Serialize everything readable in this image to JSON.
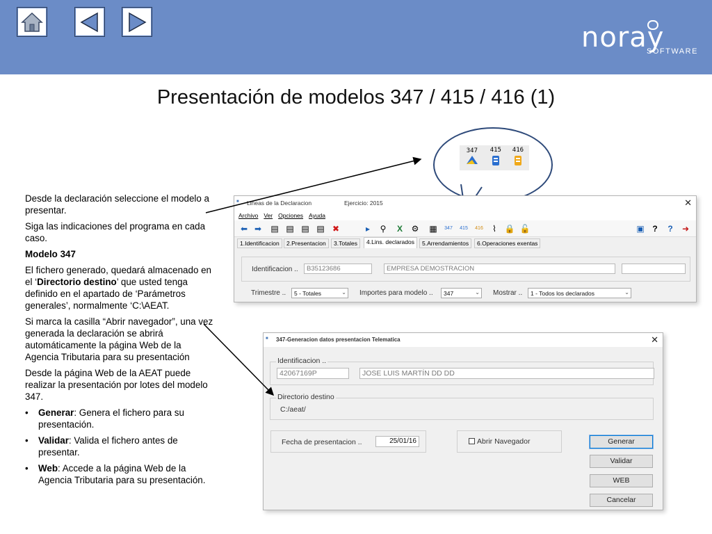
{
  "slide": {
    "title": "Presentación de modelos 347 / 415 / 416 (1)"
  },
  "header": {
    "logo_main": "noray",
    "logo_sub": "SOFTWARE",
    "nav": [
      "home-icon",
      "previous-icon",
      "next-icon"
    ]
  },
  "instructions": {
    "p1": "Desde la declaración seleccione el modelo a presentar.",
    "p2": "Siga las indicaciones del programa en cada caso.",
    "heading": "Modelo 347",
    "p3_a": "El fichero generado, quedará almacenado en el ‘",
    "p3_b": "Directorio destino",
    "p3_c": "’ que usted tenga definido en el apartado de ‘Parámetros generales’, normalmente ‘C:\\AEAT.",
    "p4": "Si marca la casilla “Abrir navegador”, una vez generada la declaración se abrirá automáticamente la página Web de la Agencia Tributaria para su presentación",
    "p5": "Desde la página Web de la AEAT puede realizar la presentación por lotes del modelo 347.",
    "bullets": [
      {
        "term": "Generar",
        "text": ": Genera el fichero para su presentación."
      },
      {
        "term": "Validar",
        "text": ": Valida el fichero antes de presentar."
      },
      {
        "term": "Web",
        "text": ": Accede a la página Web de la Agencia Tributaria para su presentación."
      }
    ]
  },
  "callout": {
    "icons": [
      "347",
      "415",
      "416"
    ]
  },
  "window1": {
    "title": "Lineas de la Declaracion",
    "ejercicio": "Ejercicio: 2015",
    "menu": [
      "Archivo",
      "Ver",
      "Opciones",
      "Ayuda"
    ],
    "tabs": [
      "1.Identificacion",
      "2.Presentacion",
      "3.Totales",
      "4.Lins. declarados",
      "5.Arrendamientos",
      "6.Operaciones exentas"
    ],
    "identificacion_label": "Identificacion ..",
    "nif": "B35123686",
    "empresa": "EMPRESA DEMOSTRACION",
    "trimestre_label": "Trimestre ..",
    "trimestre_value": "5 - Totales",
    "importes_label": "Importes para modelo ..",
    "importes_value": "347",
    "mostrar_label": "Mostrar ..",
    "mostrar_value": "1 - Todos los declarados"
  },
  "window2": {
    "title": "347-Generacion datos presentacion Telematica",
    "identificacion_label": "Identificacion ..",
    "nif": "42067169P",
    "nombre": "JOSE LUIS MARTÍN   DD DD",
    "directorio_label": "Directorio destino",
    "directorio_value": "C:/aeat/",
    "fecha_label": "Fecha de presentacion ..",
    "fecha_value": "25/01/16",
    "abrir_label": "Abrir Navegador",
    "abrir_checked": false,
    "buttons": {
      "generar": "Generar",
      "validar": "Validar",
      "web": "WEB",
      "cancelar": "Cancelar"
    }
  }
}
